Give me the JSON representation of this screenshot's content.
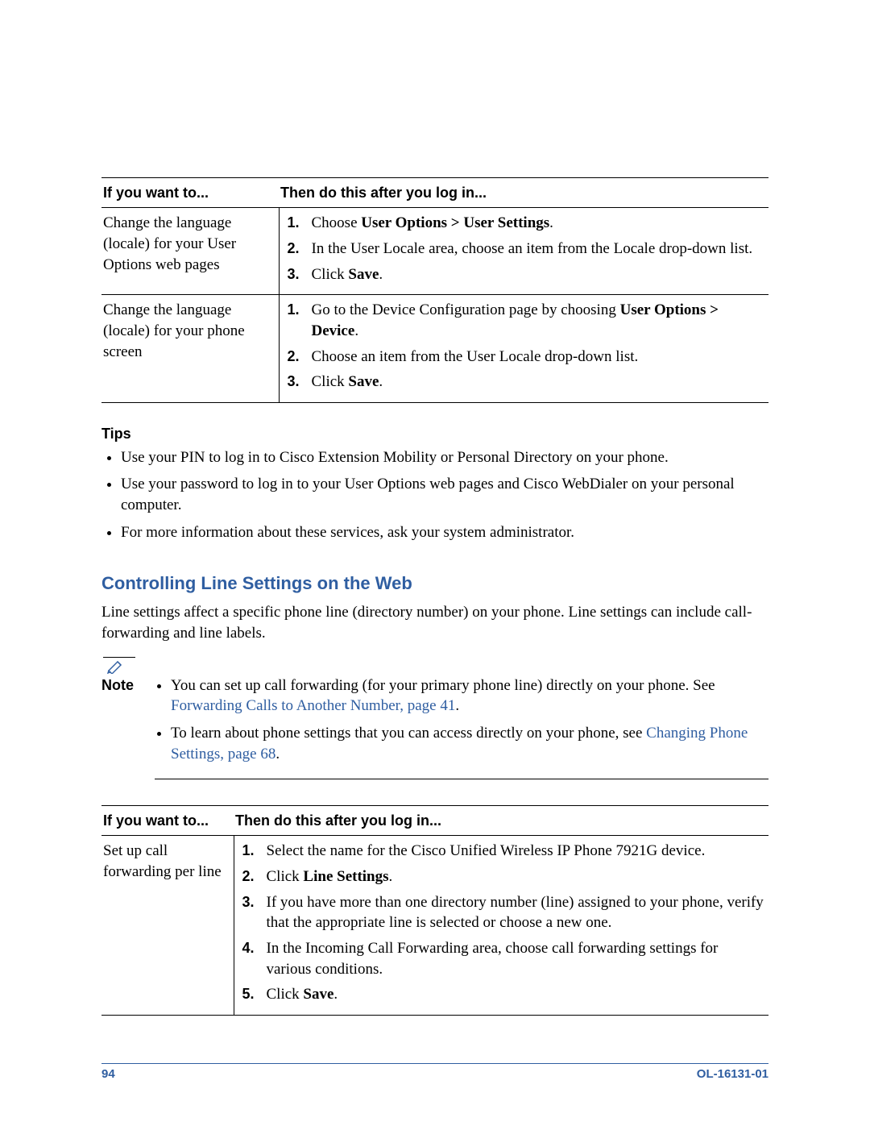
{
  "table1": {
    "headers": [
      "If you want to...",
      "Then do this after you log in..."
    ],
    "rows": [
      {
        "want": "Change the language (locale) for your User Options web pages",
        "steps": [
          {
            "pre": "Choose ",
            "bold": "User Options > User Settings",
            "post": "."
          },
          {
            "pre": "In the User Locale area, choose an item from the Locale drop-down list.",
            "bold": "",
            "post": ""
          },
          {
            "pre": "Click ",
            "bold": "Save",
            "post": "."
          }
        ]
      },
      {
        "want": "Change the language (locale) for your phone screen",
        "steps": [
          {
            "pre": "Go to the Device Configuration page by choosing ",
            "bold": "User Options > Device",
            "post": "."
          },
          {
            "pre": "Choose an item from the User Locale drop-down list.",
            "bold": "",
            "post": ""
          },
          {
            "pre": "Click ",
            "bold": "Save",
            "post": "."
          }
        ]
      }
    ]
  },
  "tips": {
    "heading": "Tips",
    "items": [
      "Use your PIN to log in to Cisco Extension Mobility or Personal Directory on your phone.",
      "Use your password to log in to your User Options web pages and Cisco WebDialer on your personal computer.",
      "For more information about these services, ask your system administrator."
    ]
  },
  "section": {
    "heading": "Controlling Line Settings on the Web",
    "para": "Line settings affect a specific phone line (directory number) on your phone. Line settings can include call-forwarding and line labels."
  },
  "note": {
    "label": "Note",
    "items": [
      {
        "pre": "You can set up call forwarding (for your primary phone line) directly on your phone. See ",
        "link": "Forwarding Calls to Another Number, page 41",
        "post": "."
      },
      {
        "pre": "To learn about phone settings that you can access directly on your phone, see ",
        "link": "Changing Phone Settings, page 68",
        "post": "."
      }
    ]
  },
  "table2": {
    "headers": [
      "If you want to...",
      "Then do this after you log in..."
    ],
    "rows": [
      {
        "want": "Set up call forwarding per line",
        "steps": [
          {
            "pre": "Select the name for the Cisco Unified Wireless IP Phone 7921G device.",
            "bold": "",
            "post": ""
          },
          {
            "pre": "Click ",
            "bold": "Line Settings",
            "post": "."
          },
          {
            "pre": "If you have more than one directory number (line) assigned to your phone, verify that the appropriate line is selected or choose a new one.",
            "bold": "",
            "post": ""
          },
          {
            "pre": "In the Incoming Call Forwarding area, choose call forwarding settings for various conditions.",
            "bold": "",
            "post": ""
          },
          {
            "pre": "Click ",
            "bold": "Save",
            "post": "."
          }
        ]
      }
    ]
  },
  "footer": {
    "page": "94",
    "docid": "OL-16131-01"
  }
}
